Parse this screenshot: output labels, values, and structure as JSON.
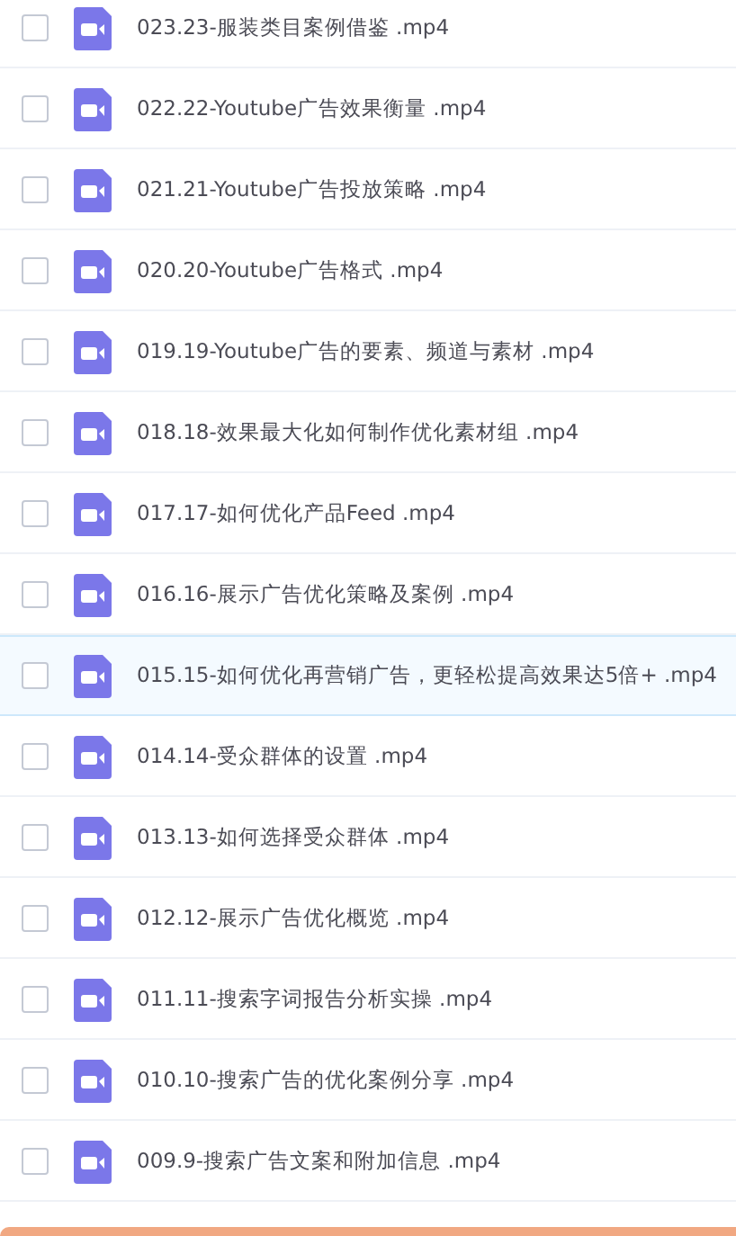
{
  "files": [
    {
      "name": "023.23-服装类目案例借鉴 .mp4",
      "checked": false,
      "selected": false
    },
    {
      "name": "022.22-Youtube广告效果衡量 .mp4",
      "checked": false,
      "selected": false
    },
    {
      "name": "021.21-Youtube广告投放策略 .mp4",
      "checked": false,
      "selected": false
    },
    {
      "name": "020.20-Youtube广告格式 .mp4",
      "checked": false,
      "selected": false
    },
    {
      "name": "019.19-Youtube广告的要素、频道与素材 .mp4",
      "checked": false,
      "selected": false
    },
    {
      "name": "018.18-效果最大化如何制作优化素材组 .mp4",
      "checked": false,
      "selected": false
    },
    {
      "name": "017.17-如何优化产品Feed .mp4",
      "checked": false,
      "selected": false
    },
    {
      "name": "016.16-展示广告优化策略及案例 .mp4",
      "checked": false,
      "selected": false
    },
    {
      "name": "015.15-如何优化再营销广告，更轻松提高效果达5倍+ .mp4",
      "checked": false,
      "selected": true
    },
    {
      "name": "014.14-受众群体的设置 .mp4",
      "checked": false,
      "selected": false
    },
    {
      "name": "013.13-如何选择受众群体 .mp4",
      "checked": false,
      "selected": false
    },
    {
      "name": "012.12-展示广告优化概览 .mp4",
      "checked": false,
      "selected": false
    },
    {
      "name": "011.11-搜索字词报告分析实操 .mp4",
      "checked": false,
      "selected": false
    },
    {
      "name": "010.10-搜索广告的优化案例分享 .mp4",
      "checked": false,
      "selected": false
    },
    {
      "name": "009.9-搜索广告文案和附加信息 .mp4",
      "checked": false,
      "selected": false
    }
  ]
}
